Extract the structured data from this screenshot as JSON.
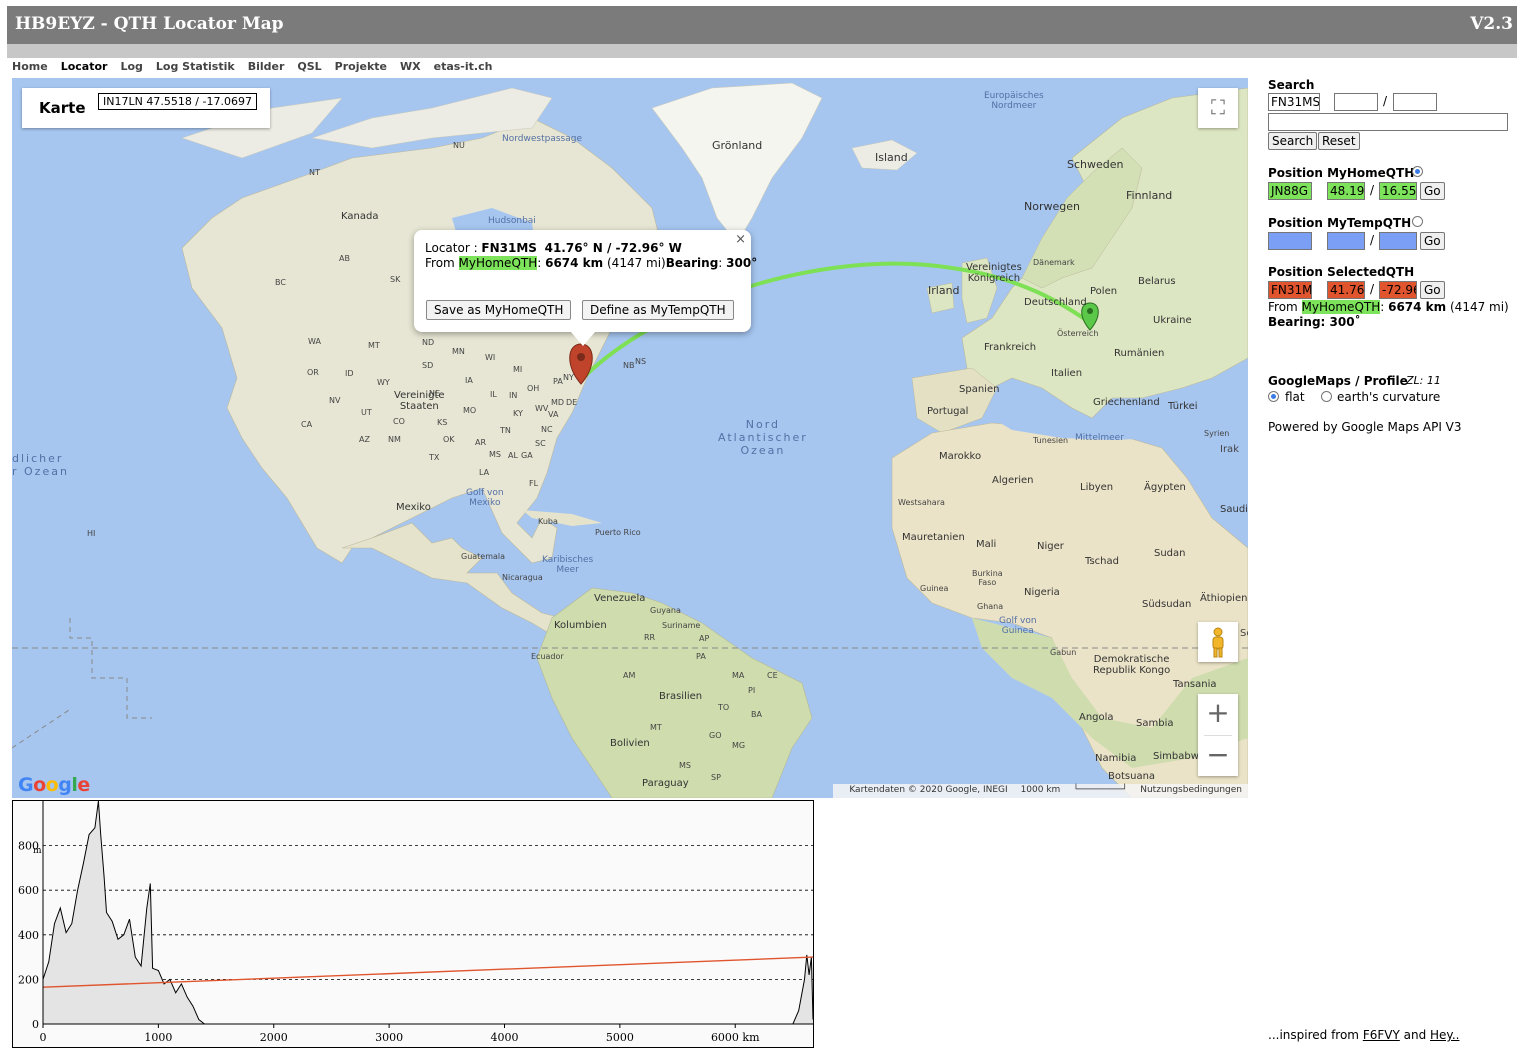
{
  "header": {
    "title": "HB9EYZ - QTH Locator Map",
    "version": "V2.3"
  },
  "nav": [
    "Home",
    "Locator",
    "Log",
    "Log Statistik",
    "Bilder",
    "QSL",
    "Projekte",
    "WX",
    "etas-it.ch"
  ],
  "map": {
    "karte_label": "Karte",
    "cursor_locator": "IN17LN 47.5518 / -17.0697",
    "google_logo": "Google",
    "attribution": "Kartendaten © 2020 Google, INEGI",
    "scale": "1000 km",
    "terms": "Nutzungsbedingungen",
    "labels": {
      "europaisches_nordmeer": "Europäisches\nNordmeer",
      "gronland": "Grönland",
      "island": "Island",
      "schweden": "Schweden",
      "finnland": "Finnland",
      "norwegen": "Norwegen",
      "danemark": "Dänemark",
      "vereinigtes_konigreich": "Vereinigtes\nKönigreich",
      "irland": "Irland",
      "deutschland": "Deutschland",
      "polen": "Polen",
      "belarus": "Belarus",
      "ukraine": "Ukraine",
      "osterreich": "Österreich",
      "frankreich": "Frankreich",
      "rumanien": "Rumänien",
      "italien": "Italien",
      "spanien": "Spanien",
      "portugal": "Portugal",
      "griechenland": "Griechenland",
      "turkei": "Türkei",
      "tunesien": "Tunesien",
      "mittelmeer": "Mittelmeer",
      "syrien": "Syrien",
      "irak": "Irak",
      "marokko": "Marokko",
      "algerien": "Algerien",
      "libyen": "Libyen",
      "agypten": "Ägypten",
      "saudi": "Saudi",
      "westsahara": "Westsahara",
      "mauretanien": "Mauretanien",
      "mali": "Mali",
      "niger": "Niger",
      "tschad": "Tschad",
      "sudan": "Sudan",
      "burkina": "Burkina\nFaso",
      "guinea": "Guinea",
      "ghana": "Ghana",
      "nigeria": "Nigeria",
      "sudsudan": "Südsudan",
      "athiopien": "Äthiopien",
      "golf_guinea": "Golf von\nGuinea",
      "gabun": "Gabun",
      "dr_kongo": "Demokratische\nRepublik Kongo",
      "tansania": "Tansania",
      "angola": "Angola",
      "sambia": "Sambia",
      "namibia": "Namibia",
      "simbabwe": "Simbabwe",
      "botsuana": "Botsuana",
      "nu": "NU",
      "nordwestpassage": "Nordwestpassage",
      "nt": "NT",
      "kanada": "Kanada",
      "hudsonbai": "Hudsonbai",
      "vereinigte_staaten": "Vereinigte\nStaaten",
      "mexiko": "Mexiko",
      "golf_mexiko": "Golf von\nMexiko",
      "kuba": "Kuba",
      "puerto_rico": "Puerto Rico",
      "guatemala": "Guatemala",
      "nicaragua": "Nicaragua",
      "karibisches_meer": "Karibisches\nMeer",
      "venezuela": "Venezuela",
      "guyana": "Guyana",
      "suriname": "Suriname",
      "kolumbien": "Kolumbien",
      "ecuador": "Ecuador",
      "brasilien": "Brasilien",
      "bolivien": "Bolivien",
      "paraguay": "Paraguay",
      "nord_atlantischer_ozean": "Nord\nAtlantischer\nOzean",
      "pacific_ozean": "dlicher\nr Ozean",
      "hi": "HI",
      "so": "So"
    },
    "states": [
      "AB",
      "SK",
      "MB",
      "ON",
      "QC",
      "BC",
      "WA",
      "MT",
      "ND",
      "MN",
      "OR",
      "ID",
      "WY",
      "SD",
      "WI",
      "MI",
      "NE",
      "IA",
      "IL",
      "IN",
      "OH",
      "PA",
      "NY",
      "NV",
      "UT",
      "CO",
      "KS",
      "MO",
      "KY",
      "WV",
      "VA",
      "MD",
      "DE",
      "CA",
      "AZ",
      "NM",
      "OK",
      "AR",
      "TN",
      "NC",
      "SC",
      "MS",
      "AL",
      "GA",
      "TX",
      "LA",
      "FL",
      "AM",
      "PA",
      "MA",
      "CE",
      "PI",
      "TO",
      "BA",
      "MT",
      "GO",
      "MG",
      "SP",
      "MS",
      "RR",
      "AP",
      "NB",
      "NS"
    ]
  },
  "popup": {
    "locator_prefix": "Locator : ",
    "locator": "FN31MS",
    "coords": "41.76° N / -72.96° W",
    "from_prefix": "From ",
    "home_tag": "MyHomeQTH",
    "distance": "6674 km",
    "miles": "(4147 mi)",
    "bearing_label": "Bearing",
    "bearing": "300°",
    "btn_save": "Save as MyHomeQTH",
    "btn_define": "Define as MyTempQTH",
    "close": "×"
  },
  "sidebar": {
    "search_label": "Search",
    "search_value": "FN31MS",
    "lat_value": "",
    "lon_value": "",
    "slash": "/",
    "search_btn": "Search",
    "reset_btn": "Reset",
    "home_label": "Position MyHomeQTH",
    "home_loc": "JN88G",
    "home_lat": "48.19",
    "home_lon": "16.55",
    "go": "Go",
    "temp_label": "Position MyTempQTH",
    "sel_label": "Position SelectedQTH",
    "sel_loc": "FN31M",
    "sel_lat": "41.76",
    "sel_lon": "-72.96",
    "sel_from": "From ",
    "sel_home": "MyHomeQTH",
    "sel_dist": "6674 km",
    "sel_miles": "(4147 mi)",
    "sel_bearing": "Bearing: 300˚",
    "profile_label": "GoogleMaps / Profile",
    "zl": "ZL: 11",
    "flat": "flat",
    "curv": "earth's curvature",
    "powered": "Powered by Google Maps API V3",
    "colors": {
      "home": "#7ce35a",
      "temp": "#7b9ff5",
      "selected": "#e0552e"
    }
  },
  "profile": {
    "y_unit": "m",
    "y_ticks": [
      "0",
      "200",
      "400",
      "600",
      "800"
    ],
    "x_ticks": [
      "0",
      "1000",
      "2000",
      "3000",
      "4000",
      "5000",
      "6000 km"
    ]
  },
  "chart_data": {
    "type": "area",
    "x_unit": "km",
    "y_unit": "m",
    "xlim": [
      0,
      6674
    ],
    "ylim": [
      0,
      1000
    ],
    "elevation": {
      "x": [
        0,
        50,
        100,
        150,
        200,
        250,
        300,
        350,
        400,
        450,
        480,
        500,
        530,
        550,
        600,
        650,
        700,
        750,
        800,
        850,
        900,
        930,
        950,
        1000,
        1050,
        1100,
        1150,
        1200,
        1250,
        1300,
        1350,
        1400,
        6500,
        6550,
        6600,
        6620,
        6640,
        6660,
        6674
      ],
      "y": [
        200,
        280,
        450,
        520,
        410,
        450,
        600,
        720,
        850,
        880,
        1000,
        850,
        660,
        500,
        460,
        380,
        400,
        470,
        300,
        260,
        520,
        630,
        250,
        240,
        180,
        200,
        140,
        180,
        120,
        80,
        20,
        0,
        0,
        60,
        200,
        310,
        220,
        300,
        20
      ]
    },
    "line_of_sight": {
      "x": [
        0,
        6674
      ],
      "y": [
        165,
        300
      ]
    }
  },
  "footer": {
    "prefix": "...inspired from ",
    "f6fvy": "F6FVY",
    "and": " and ",
    "hey": "Hey.."
  }
}
